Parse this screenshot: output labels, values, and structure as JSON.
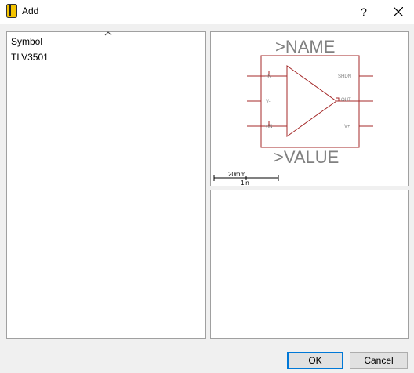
{
  "window": {
    "title": "Add",
    "help_label": "?"
  },
  "icons": {
    "app": "eagle-app-icon",
    "close": "close-icon",
    "sort": "sort-up-caret-icon"
  },
  "list": {
    "column_header": "Symbol",
    "items": [
      "TLV3501"
    ]
  },
  "preview": {
    "name_placeholder": ">NAME",
    "value_placeholder": ">VALUE",
    "pins_left": [
      "-IN",
      "V-",
      "+IN"
    ],
    "pins_right": [
      "SHDN",
      "OUT",
      "V+"
    ],
    "scale_metric": "20mm",
    "scale_imperial": "1in",
    "symbol_color": "#a52a2a",
    "pin_text_color": "#808080"
  },
  "buttons": {
    "ok": "OK",
    "cancel": "Cancel"
  }
}
